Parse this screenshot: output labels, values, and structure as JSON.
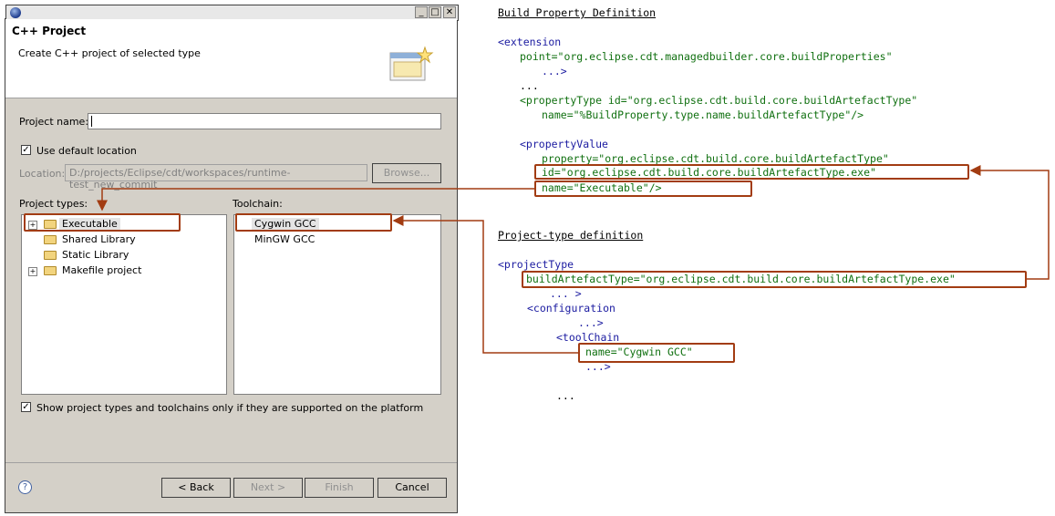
{
  "dialog": {
    "header_title": "C++ Project",
    "header_desc": "Create C++ project of selected type",
    "project_name_label": "Project name:",
    "project_name_value": "",
    "use_default_location_label": "Use default location",
    "location_label": "Location:",
    "location_value": "D:/projects/Eclipse/cdt/workspaces/runtime-test_new_commit",
    "browse_label": "Browse...",
    "project_types_label": "Project types:",
    "toolchain_label": "Toolchain:",
    "project_types": [
      "Executable",
      "Shared Library",
      "Static Library",
      "Makefile project"
    ],
    "toolchains": [
      "Cygwin GCC",
      "MinGW GCC"
    ],
    "show_supported_label": "Show project types and toolchains only if they are supported on the platform",
    "buttons": {
      "help": "?",
      "back": "< Back",
      "next": "Next >",
      "finish": "Finish",
      "cancel": "Cancel"
    },
    "window_buttons": {
      "minimize": "_",
      "maximize": "□",
      "close": "✕"
    }
  },
  "code": {
    "build_property_heading": "Build Property Definition",
    "bp_lines": [
      "<extension",
      "point=\"org.eclipse.cdt.managedbuilder.core.buildProperties\"",
      "...>",
      "...",
      "<propertyType id=\"org.eclipse.cdt.build.core.buildArtefactType\"",
      "name=\"%BuildProperty.type.name.buildArtefactType\"/>",
      "<propertyValue",
      "property=\"org.eclipse.cdt.build.core.buildArtefactType\"",
      "id=\"org.eclipse.cdt.build.core.buildArtefactType.exe\"",
      "name=\"Executable\"/>"
    ],
    "project_type_heading": "Project-type definition",
    "pt_lines": [
      "<projectType",
      "buildArtefactType=\"org.eclipse.cdt.build.core.buildArtefactType.exe\"",
      "... >",
      "<configuration",
      "...>",
      "<toolChain",
      "name=\"Cygwin GCC\"",
      "...>",
      "..."
    ]
  },
  "colors": {
    "dialog_bg": "#d4d0c8",
    "highlight": "#a23c12",
    "keyword": "#1a1aa0",
    "string": "#107010"
  }
}
